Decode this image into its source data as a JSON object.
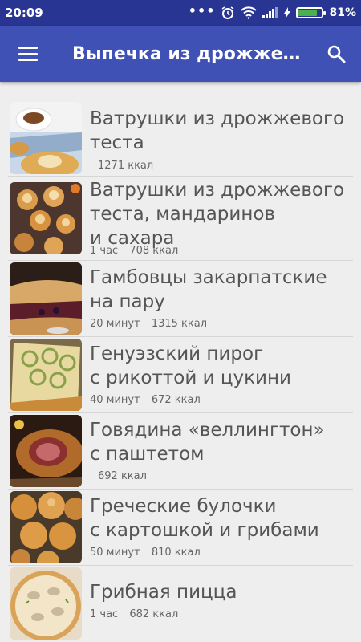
{
  "status": {
    "time": "20:09",
    "battery": "81%",
    "battery_level": 0.81
  },
  "appbar": {
    "title": "Выпечка из дрожжево…"
  },
  "recipes": [
    {
      "title_lines": [
        "Ватрушки из дрожжевого",
        "теста"
      ],
      "time": "",
      "kcal": "1271 ккал"
    },
    {
      "title_lines": [
        "Ватрушки из дрожжевого",
        "теста, мандаринов",
        "и сахара"
      ],
      "time": "1 час",
      "kcal": "708 ккал"
    },
    {
      "title_lines": [
        "Гамбовцы закарпатские",
        "на пару"
      ],
      "time": "20 минут",
      "kcal": "1315 ккал"
    },
    {
      "title_lines": [
        "Генуэзский пирог",
        "с рикоттой и цукини"
      ],
      "time": "40 минут",
      "kcal": "672 ккал"
    },
    {
      "title_lines": [
        "Говядина «веллингтон»",
        "с паштетом"
      ],
      "time": "",
      "kcal": "692 ккал"
    },
    {
      "title_lines": [
        "Греческие булочки",
        "с картошкой и грибами"
      ],
      "time": "50 минут",
      "kcal": "810 ккал"
    },
    {
      "title_lines": [
        "Грибная пицца"
      ],
      "time": "1 час",
      "kcal": "682 ккал"
    }
  ]
}
